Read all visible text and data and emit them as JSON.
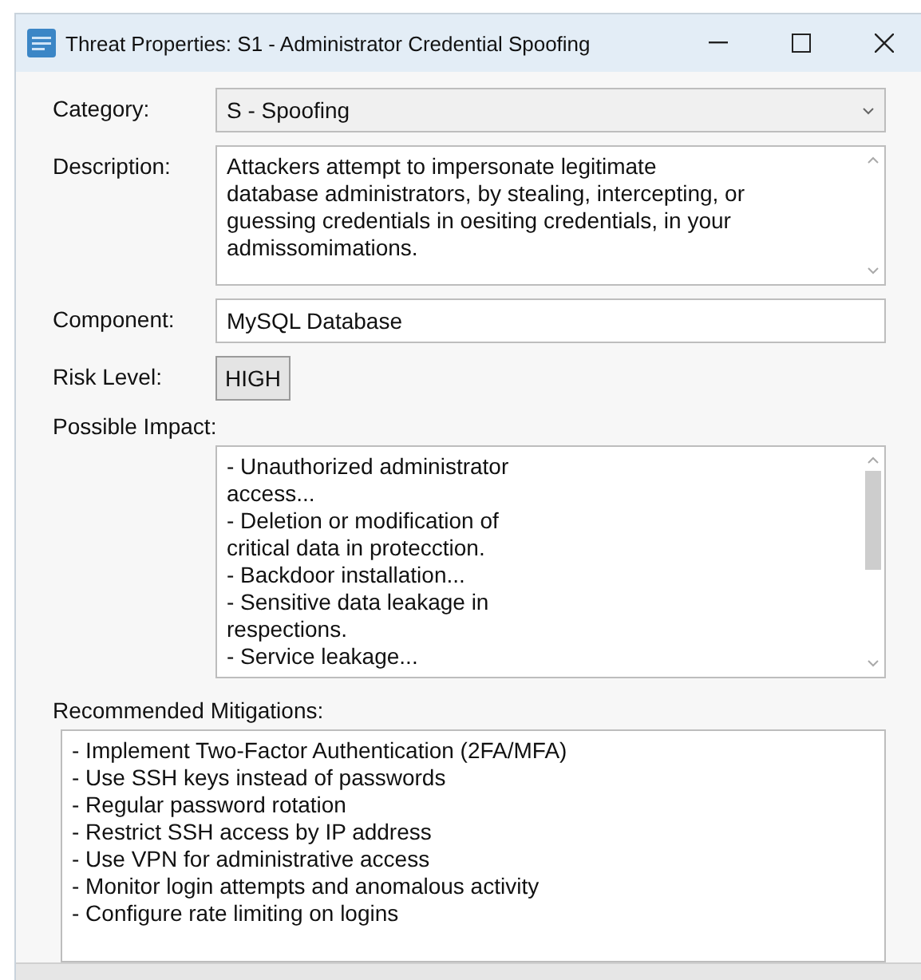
{
  "window": {
    "title": "Threat Properties: S1 - Administrator Credential Spoofing"
  },
  "category": {
    "label": "Category:",
    "value": "S - Spoofing"
  },
  "description": {
    "label": "Description:",
    "value": "Attackers attempt to impersonate legitimate database administrators, by stealing, intercepting, or guessing credentials in oesiting credentials, in your admissomimations."
  },
  "component": {
    "label": "Component:",
    "value": "MySQL Database"
  },
  "risk_level": {
    "label": "Risk Level:",
    "value": "HIGH"
  },
  "possible_impact": {
    "label": "Possible Impact:",
    "items": [
      "- Unauthorized administrator access...",
      "- Deletion or modification of critical data in protecction.",
      "- Backdoor installation...",
      "- Sensitive data leakage in respections.",
      "- Service leakage..."
    ]
  },
  "recommended_mitigations": {
    "label": "Recommended Mitigations:",
    "items": [
      "- Implement Two-Factor Authentication (2FA/MFA)",
      "- Use SSH keys instead of passwords",
      "- Regular password rotation",
      "- Restrict SSH access by IP address",
      "- Use VPN for administrative access",
      "- Monitor login attempts and anomalous activity",
      "- Configure rate limiting on logins"
    ]
  }
}
